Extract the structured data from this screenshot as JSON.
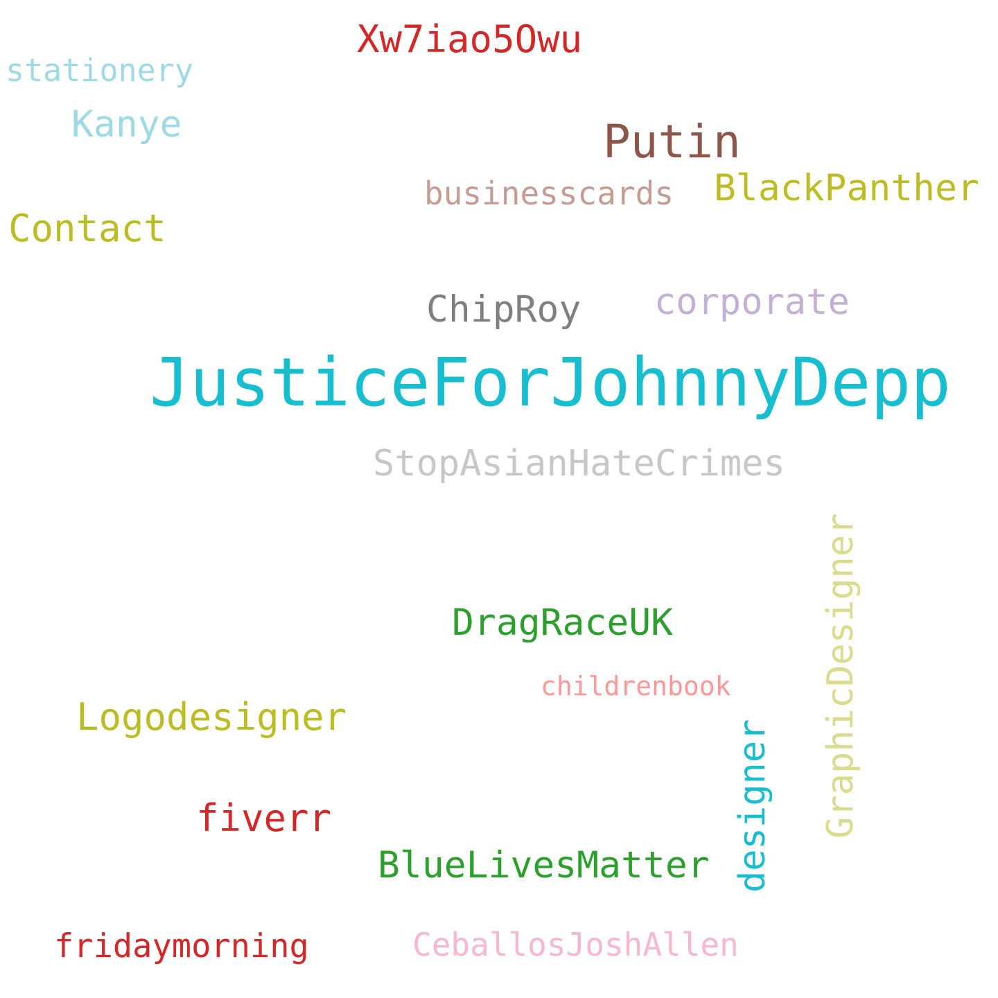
{
  "word_cloud": {
    "words": [
      {
        "text": "Xw7iao5Owu",
        "color": "#d62728"
      },
      {
        "text": "stationery",
        "color": "#9edae5"
      },
      {
        "text": "Kanye",
        "color": "#9edae5"
      },
      {
        "text": "Putin",
        "color": "#8c564b"
      },
      {
        "text": "businesscards",
        "color": "#c49c94"
      },
      {
        "text": "BlackPanther",
        "color": "#bcbd22"
      },
      {
        "text": "Contact",
        "color": "#bcbd22"
      },
      {
        "text": "ChipRoy",
        "color": "#7f7f7f"
      },
      {
        "text": "corporate",
        "color": "#c5b0d5"
      },
      {
        "text": "JusticeForJohnnyDepp",
        "color": "#17becf"
      },
      {
        "text": "StopAsianHateCrimes",
        "color": "#c7c7c7"
      },
      {
        "text": "DragRaceUK",
        "color": "#2ca02c"
      },
      {
        "text": "childrenbook",
        "color": "#ff9896"
      },
      {
        "text": "Logodesigner",
        "color": "#bcbd22"
      },
      {
        "text": "fiverr",
        "color": "#d62728"
      },
      {
        "text": "BlueLivesMatter",
        "color": "#2ca02c"
      },
      {
        "text": "fridaymorning",
        "color": "#d62728"
      },
      {
        "text": "CeballosJoshAllen",
        "color": "#f7b6d2"
      },
      {
        "text": "designer",
        "color": "#17becf"
      },
      {
        "text": "GraphicDesigner",
        "color": "#dbdb8d"
      }
    ]
  }
}
